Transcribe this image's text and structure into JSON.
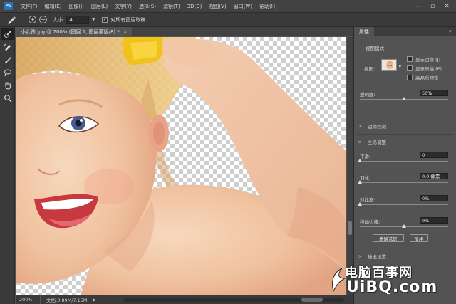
{
  "app": {
    "logo": "Ps"
  },
  "menubar": {
    "items": [
      "文件(F)",
      "编辑(E)",
      "图像(I)",
      "图层(L)",
      "文字(Y)",
      "选择(S)",
      "滤镜(T)",
      "3D(D)",
      "视图(V)",
      "窗口(W)",
      "帮助(H)"
    ],
    "window_controls": [
      "—",
      "▫",
      "✕"
    ]
  },
  "options": {
    "size_label": "大小:",
    "size_value": "4",
    "sample_all_label": "对所有图层取样",
    "sample_all_checked": true
  },
  "document": {
    "tab_title": "小女孩.jpg @ 200% (图层 1, 图层蒙版/8) *",
    "zoom": "200%",
    "doc_info": "文档:3.89M/7.15M"
  },
  "panel": {
    "tab": "属性",
    "view_mode": {
      "title": "视图模式",
      "view_label": "视图:",
      "options": [
        {
          "label": "显示边缘 (J)",
          "checked": false
        },
        {
          "label": "显示原稿 (P)",
          "checked": false
        },
        {
          "label": "高品质预览",
          "checked": false
        }
      ]
    },
    "opacity": {
      "label": "透明度:",
      "value": "50%",
      "fraction": 0.5
    },
    "edge_detection": {
      "label": "边缘检测"
    },
    "global_refine": {
      "label": "全局调整",
      "smooth": {
        "label": "平滑:",
        "value": "0",
        "fraction": 0.0
      },
      "feather": {
        "label": "羽化:",
        "value": "0.0 像素",
        "fraction": 0.0
      },
      "contrast": {
        "label": "对比度:",
        "value": "0%",
        "fraction": 0.0
      },
      "shift_edge": {
        "label": "移动边缘:",
        "value": "0%",
        "fraction": 0.5
      }
    },
    "buttons": {
      "clear": "清除选区",
      "invert": "反相"
    },
    "output": {
      "label": "输出设置"
    }
  },
  "watermark": {
    "line1": "电脑百事网",
    "line2": "UiBQ.com"
  }
}
